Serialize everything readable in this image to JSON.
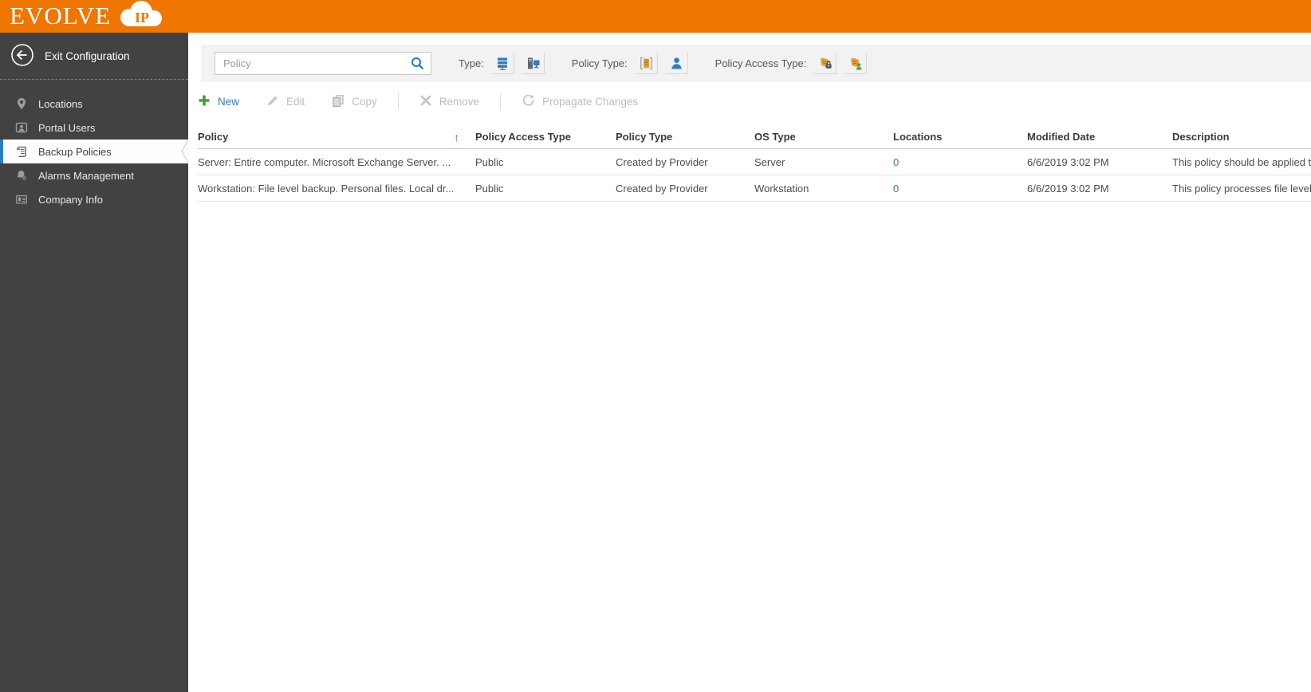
{
  "brand": {
    "logo_text": "EVOLVE",
    "logo_badge": "IP"
  },
  "sidebar": {
    "exit_label": "Exit Configuration",
    "items": [
      {
        "label": "Locations",
        "icon": "location-pin-icon",
        "selected": false
      },
      {
        "label": "Portal Users",
        "icon": "portal-user-icon",
        "selected": false
      },
      {
        "label": "Backup Policies",
        "icon": "policy-scroll-icon",
        "selected": true
      },
      {
        "label": "Alarms Management",
        "icon": "alarm-bell-icon",
        "selected": false
      },
      {
        "label": "Company Info",
        "icon": "company-info-icon",
        "selected": false
      }
    ]
  },
  "filters": {
    "search": {
      "placeholder": "Policy",
      "value": ""
    },
    "groups": [
      {
        "label": "Type:",
        "icons": [
          "server-icon",
          "workstation-icon"
        ]
      },
      {
        "label": "Policy Type:",
        "icons": [
          "provider-policy-icon",
          "user-policy-icon"
        ]
      },
      {
        "label": "Policy Access Type:",
        "icons": [
          "private-policy-lock-icon",
          "public-policy-user-icon"
        ]
      }
    ]
  },
  "actions": [
    {
      "label": "New",
      "icon": "plus-icon",
      "enabled": true
    },
    {
      "label": "Edit",
      "icon": "pencil-icon",
      "enabled": false
    },
    {
      "label": "Copy",
      "icon": "copy-icon",
      "enabled": false
    },
    {
      "label": "Remove",
      "icon": "x-icon",
      "enabled": false
    },
    {
      "label": "Propagate Changes",
      "icon": "refresh-icon",
      "enabled": false
    }
  ],
  "icons": {
    "sort_asc": "↑"
  },
  "table": {
    "columns": [
      "Policy",
      "Policy Access Type",
      "Policy Type",
      "OS Type",
      "Locations",
      "Modified Date",
      "Description"
    ],
    "sort_column": "Policy",
    "sort_direction": "ascending",
    "rows": [
      {
        "policy": "Server: Entire computer. Microsoft Exchange Server. ...",
        "access_type": "Public",
        "policy_type": "Created by Provider",
        "os_type": "Server",
        "locations": "0",
        "modified": "6/6/2019 3:02 PM",
        "description": "This policy should be applied to servers"
      },
      {
        "policy": "Workstation: File level backup. Personal files. Local dr...",
        "access_type": "Public",
        "policy_type": "Created by Provider",
        "os_type": "Workstation",
        "locations": "0",
        "modified": "6/6/2019 3:02 PM",
        "description": "This policy processes file level backups"
      }
    ]
  },
  "colors": {
    "brand_orange": "#EE7601",
    "sidebar_bg": "#424242",
    "accent_blue": "#2D7DC1",
    "action_green": "#3FA23C",
    "scroll_gold": "#E8A33D",
    "public_green": "#4AA546"
  }
}
